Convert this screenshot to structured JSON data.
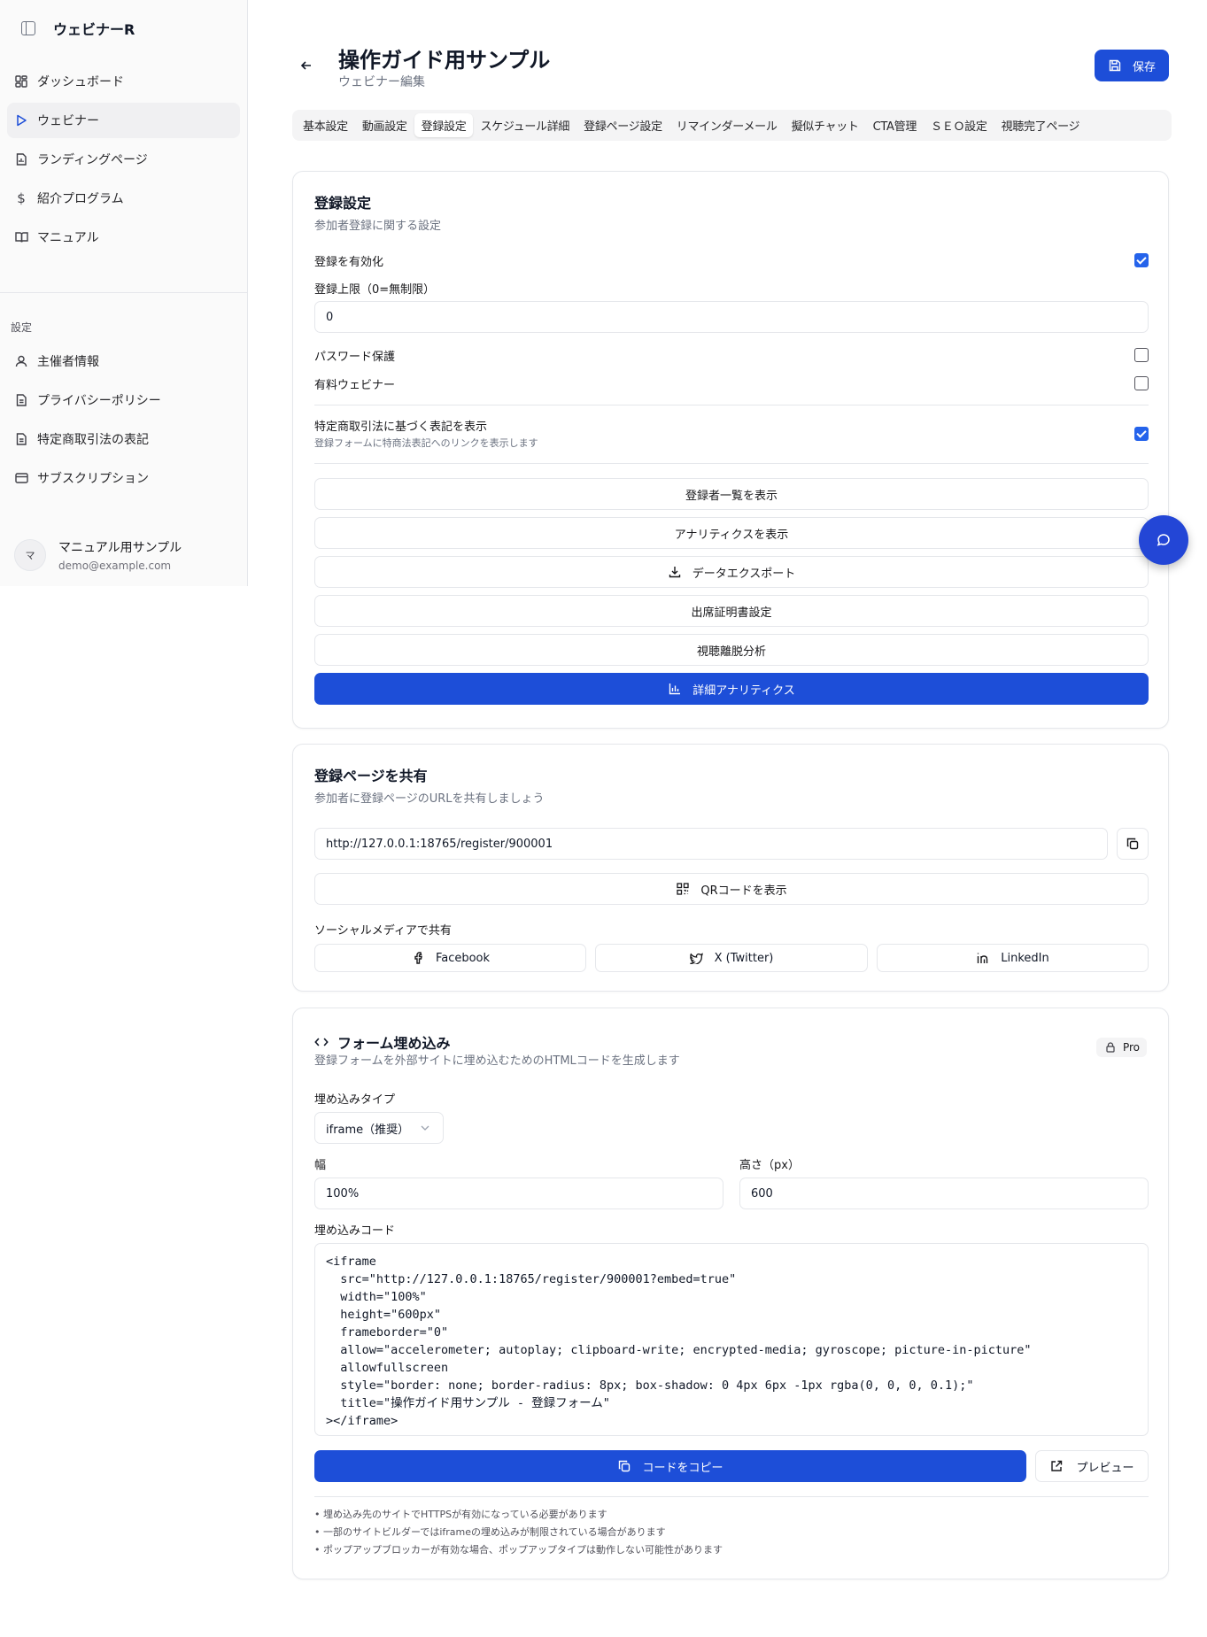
{
  "sidebar": {
    "brand": "ウェビナーR",
    "items": [
      {
        "label": "ダッシュボード"
      },
      {
        "label": "ウェビナー"
      },
      {
        "label": "ランディングページ"
      },
      {
        "label": "紹介プログラム"
      },
      {
        "label": "マニュアル"
      }
    ],
    "settings_group": "設定",
    "settings_items": [
      {
        "label": "主催者情報"
      },
      {
        "label": "プライバシーポリシー"
      },
      {
        "label": "特定商取引法の表記"
      },
      {
        "label": "サブスクリプション"
      }
    ],
    "user": {
      "initial": "マ",
      "name": "マニュアル用サンプル",
      "email": "demo@example.com"
    }
  },
  "header": {
    "title": "操作ガイド用サンプル",
    "subtitle": "ウェビナー編集",
    "save_label": "保存"
  },
  "tabs": [
    {
      "label": "基本設定"
    },
    {
      "label": "動画設定"
    },
    {
      "label": "登録設定"
    },
    {
      "label": "スケジュール詳細"
    },
    {
      "label": "登録ページ設定"
    },
    {
      "label": "リマインダーメール"
    },
    {
      "label": "擬似チャット"
    },
    {
      "label": "CTA管理"
    },
    {
      "label": "ＳＥＯ設定"
    },
    {
      "label": "視聴完了ページ"
    }
  ],
  "registration": {
    "title": "登録設定",
    "desc": "参加者登録に関する設定",
    "enable_label": "登録を有効化",
    "enable_checked": true,
    "limit_label": "登録上限（0=無制限）",
    "limit_value": "0",
    "password_label": "パスワード保護",
    "password_checked": false,
    "paid_label": "有料ウェビナー",
    "paid_checked": false,
    "tokusho_label": "特定商取引法に基づく表記を表示",
    "tokusho_desc": "登録フォームに特商法表記へのリンクを表示します",
    "tokusho_checked": true,
    "buttons": {
      "registrants": "登録者一覧を表示",
      "analytics": "アナリティクスを表示",
      "export": "データエクスポート",
      "certificate": "出席証明書設定",
      "dropoff": "視聴離脱分析",
      "detailed": "詳細アナリティクス"
    }
  },
  "share": {
    "title": "登録ページを共有",
    "desc": "参加者に登録ページのURLを共有しましょう",
    "url": "http://127.0.0.1:18765/register/900001",
    "qr_label": "QRコードを表示",
    "social_label": "ソーシャルメディアで共有",
    "facebook": "Facebook",
    "twitter": "X (Twitter)",
    "linkedin": "LinkedIn"
  },
  "embed": {
    "title": "フォーム埋め込み",
    "desc": "登録フォームを外部サイトに埋め込むためのHTMLコードを生成します",
    "pro_badge": "Pro",
    "type_label": "埋め込みタイプ",
    "type_value": "iframe（推奨）",
    "width_label": "幅",
    "width_value": "100%",
    "height_label": "高さ（px）",
    "height_value": "600",
    "code_label": "埋め込みコード",
    "code": "<iframe\n  src=\"http://127.0.0.1:18765/register/900001?embed=true\"\n  width=\"100%\"\n  height=\"600px\"\n  frameborder=\"0\"\n  allow=\"accelerometer; autoplay; clipboard-write; encrypted-media; gyroscope; picture-in-picture\"\n  allowfullscreen\n  style=\"border: none; border-radius: 8px; box-shadow: 0 4px 6px -1px rgba(0, 0, 0, 0.1);\"\n  title=\"操作ガイド用サンプル - 登録フォーム\"\n></iframe>",
    "copy_label": "コードをコピー",
    "preview_label": "プレビュー",
    "notes": [
      "• 埋め込み先のサイトでHTTPSが有効になっている必要があります",
      "• 一部のサイトビルダーではiframeの埋め込みが制限されている場合があります",
      "• ポップアップブロッカーが有効な場合、ポップアップタイプは動作しない可能性があります"
    ]
  },
  "colors": {
    "primary": "#1d4ed8",
    "checkbox": "#2563eb",
    "border": "#e5e7eb"
  }
}
